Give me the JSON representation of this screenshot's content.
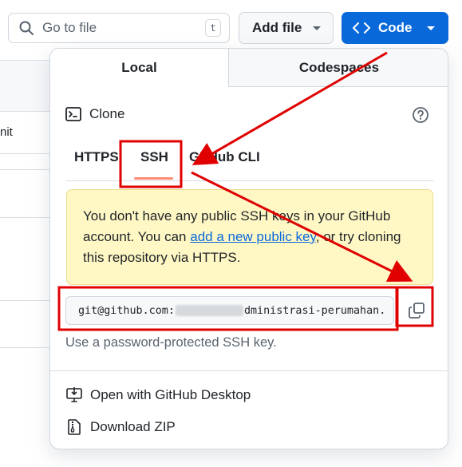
{
  "background": {
    "partial_text": "nit"
  },
  "topbar": {
    "search_placeholder": "Go to file",
    "search_shortcut": "t",
    "add_file_label": "Add file",
    "code_label": "Code",
    "code_color": "#0969da"
  },
  "dropdown": {
    "tabs": [
      {
        "label": "Local",
        "selected": true
      },
      {
        "label": "Codespaces",
        "selected": false
      }
    ],
    "clone_title": "Clone",
    "subtabs": [
      {
        "label": "HTTPS"
      },
      {
        "label": "SSH",
        "selected": true
      },
      {
        "label": "GitHub CLI"
      }
    ],
    "warning": {
      "text_before": "You don't have any public SSH keys in your GitHub account. You can ",
      "link": "add a new public key",
      "text_after": ", or try cloning this repository via HTTPS."
    },
    "clone_url_prefix": "git@github.com:",
    "clone_url_suffix": "dministrasi-perumahan.",
    "hint": "Use a password-protected SSH key.",
    "actions": [
      {
        "label": "Open with GitHub Desktop",
        "icon": "desktop-download-icon"
      },
      {
        "label": "Download ZIP",
        "icon": "file-zip-icon"
      }
    ]
  },
  "annotation_color": "#e00000"
}
